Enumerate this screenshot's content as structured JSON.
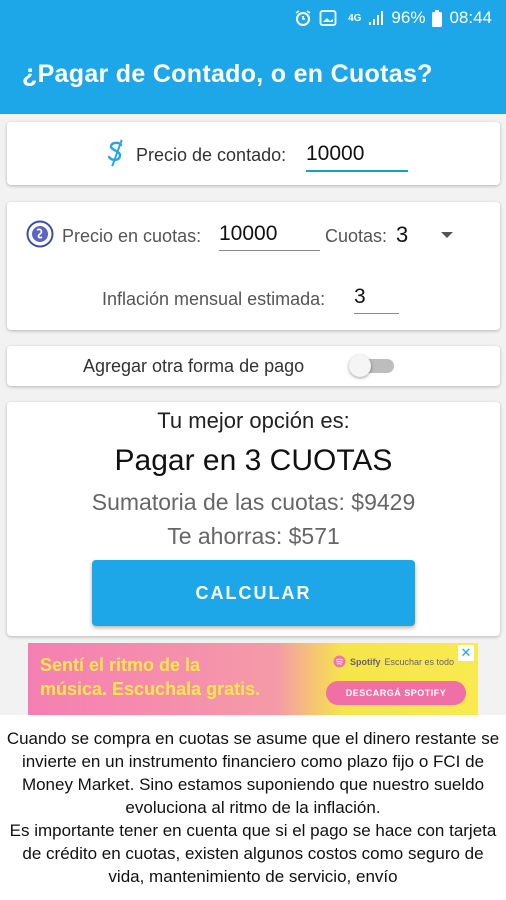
{
  "status_bar": {
    "network": "4G",
    "battery": "96%",
    "time": "08:44"
  },
  "app_bar": {
    "title": "¿Pagar de Contado, o en Cuotas?"
  },
  "cash_card": {
    "label": "Precio de contado:",
    "value": "10000",
    "icon": "dollar-sign-icon"
  },
  "installments_card": {
    "price_label": "Precio en cuotas:",
    "price_value": "10000",
    "installments_label": "Cuotas:",
    "installments_value": "3",
    "inflation_label": "Inflación mensual estimada:",
    "inflation_value": "3",
    "icon": "coin-icon"
  },
  "add_payment": {
    "label": "Agregar otra forma de pago",
    "enabled": false
  },
  "result": {
    "heading": "Tu mejor opción es:",
    "choice": "Pagar en 3 CUOTAS",
    "sum": "Sumatoria de las cuotas: $9429",
    "savings": "Te ahorras: $571",
    "button_label": "CALCULAR"
  },
  "ad": {
    "headline_1": "Sentí el ritmo de la",
    "headline_2": "música. Escuchala gratis.",
    "brand": "Spotify",
    "brand_sub": "Escuchar es todo",
    "cta": "DESCARGÁ SPOTIFY"
  },
  "info_text": "Cuando se compra en cuotas se asume que el dinero restante se invierte en un instrumento financiero como plazo fijo o FCI de Money Market. Sino estamos suponiendo que nuestro sueldo evoluciona al ritmo de la inflación.\nEs importante tener en cuenta que si el pago se hace con tarjeta de crédito en cuotas, existen algunos costos como seguro de vida, mantenimiento de servicio, envío"
}
